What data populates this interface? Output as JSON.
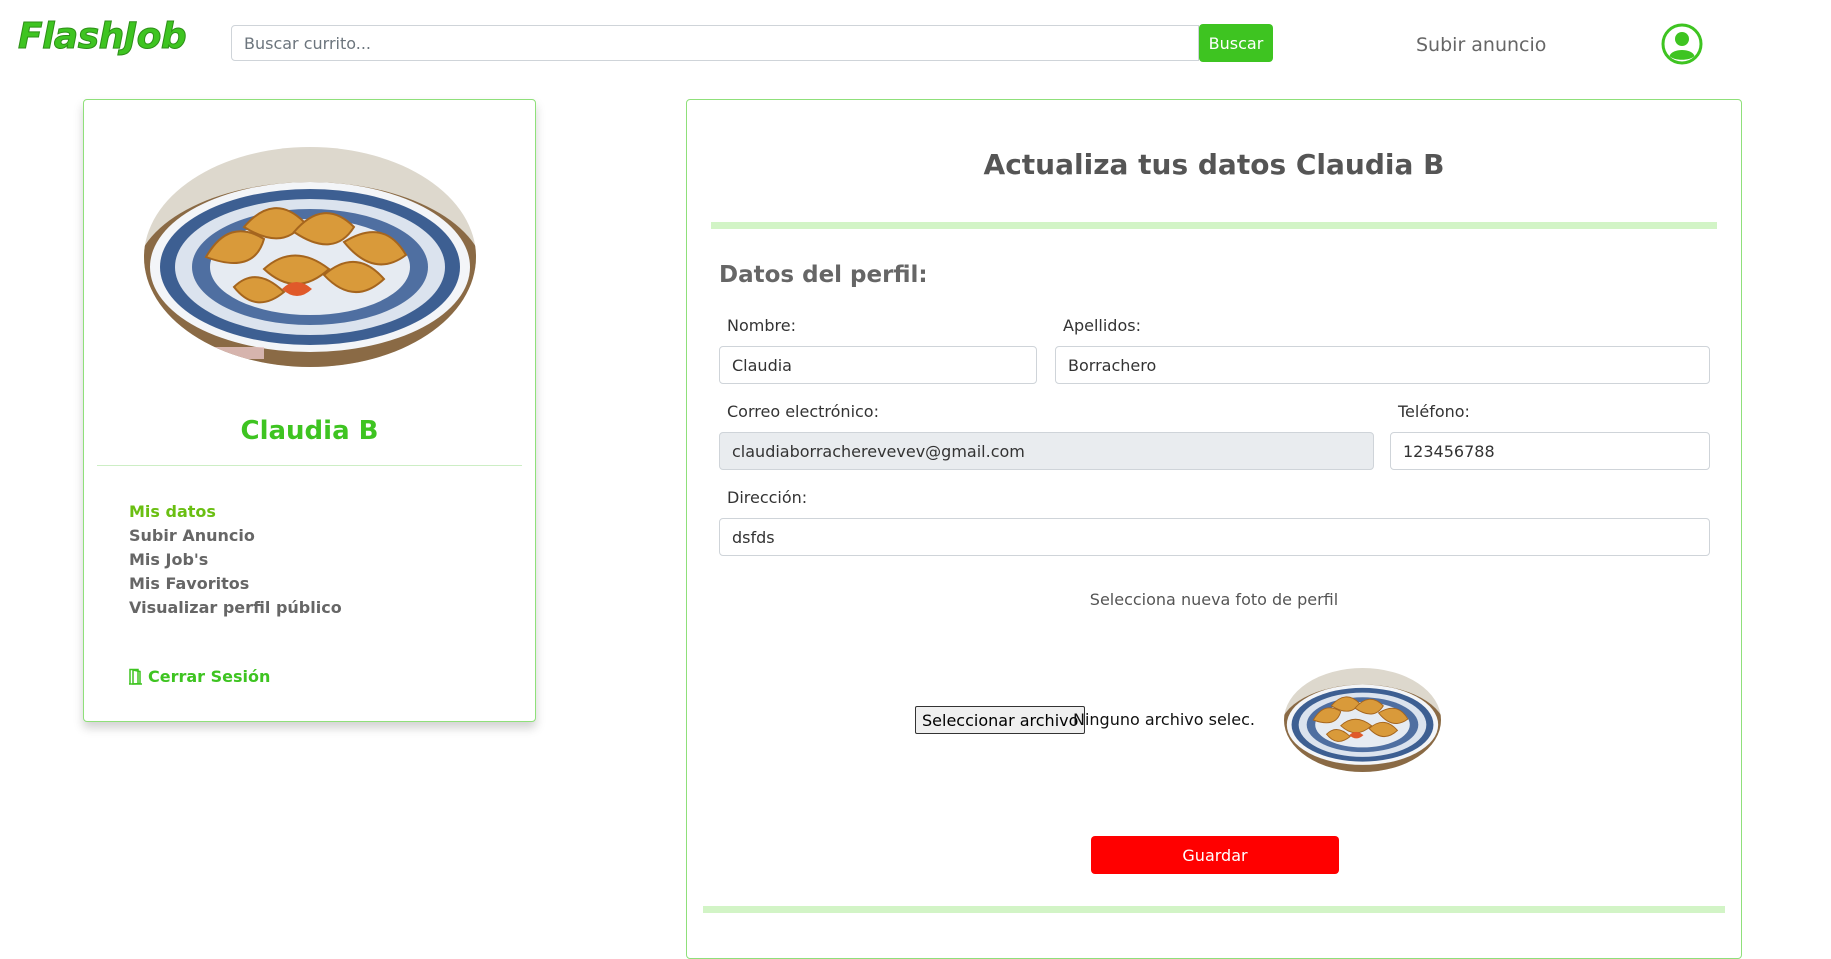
{
  "header": {
    "logo": "FlashJob",
    "search_placeholder": "Buscar currito...",
    "search_button": "Buscar",
    "upload_link": "Subir anuncio",
    "user_icon": "user-circle-icon"
  },
  "profile": {
    "name": "Claudia B",
    "photo": "empanadas-plate-photo",
    "menu": [
      {
        "label": "Mis datos",
        "active": true
      },
      {
        "label": "Subir Anuncio",
        "active": false
      },
      {
        "label": "Mis Job's",
        "active": false
      },
      {
        "label": "Mis Favoritos",
        "active": false
      },
      {
        "label": "Visualizar perfil público",
        "active": false
      }
    ],
    "logout_icon": "door-icon",
    "logout": "Cerrar Sesión"
  },
  "form": {
    "title": "Actualiza tus datos Claudia B",
    "section_title": "Datos del perfil:",
    "fields": {
      "nombre": {
        "label": "Nombre:",
        "value": "Claudia"
      },
      "apellidos": {
        "label": "Apellidos:",
        "value": "Borrachero"
      },
      "correo": {
        "label": "Correo electrónico:",
        "value": "claudiaborracherevevev@gmail.com"
      },
      "telefono": {
        "label": "Teléfono:",
        "value": "123456788"
      },
      "direccion": {
        "label": "Dirección:",
        "value": "dsfds"
      }
    },
    "photo_caption": "Selecciona nueva foto de perfil",
    "file_button": "Seleccionar archivo",
    "file_status": "Ninguno archivo selec.",
    "save_button": "Guardar"
  },
  "colors": {
    "brand_green": "#3ec421",
    "active_menu": "#6abf12",
    "save_red": "#ff0000",
    "band_green": "#d2f4c6"
  }
}
